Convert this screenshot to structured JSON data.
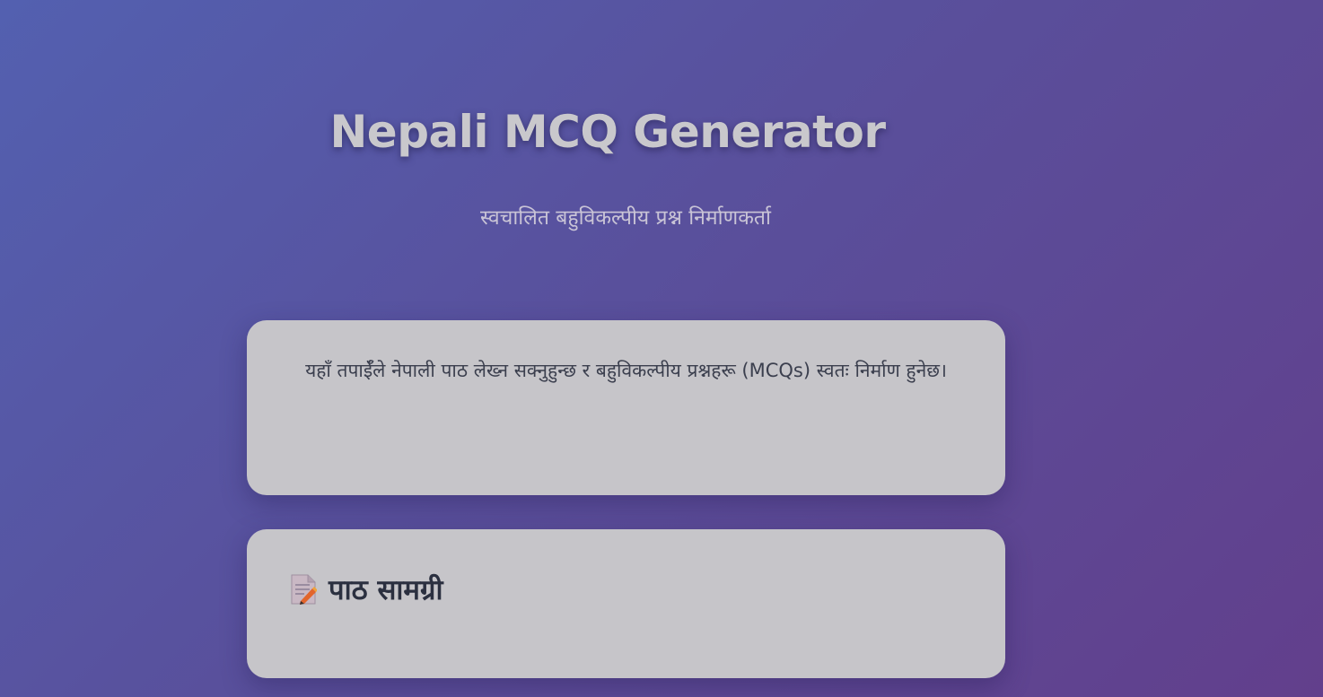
{
  "header": {
    "title": "Nepali MCQ Generator",
    "subtitle": "स्वचालित बहुविकल्पीय प्रश्न निर्माणकर्ता"
  },
  "intro": {
    "text": "यहाँ तपाईँले नेपाली पाठ लेख्न सक्नुहुन्छ र बहुविकल्पीय प्रश्नहरू (MCQs) स्वतः निर्माण हुनेछ।"
  },
  "content_section": {
    "icon": "memo-icon",
    "title": "पाठ सामग्री"
  },
  "colors": {
    "background_start": "#5360b0",
    "background_end": "#623f8c",
    "card": "#c6c5c9",
    "title": "#c9c8cc",
    "text": "#3b3f4e"
  }
}
